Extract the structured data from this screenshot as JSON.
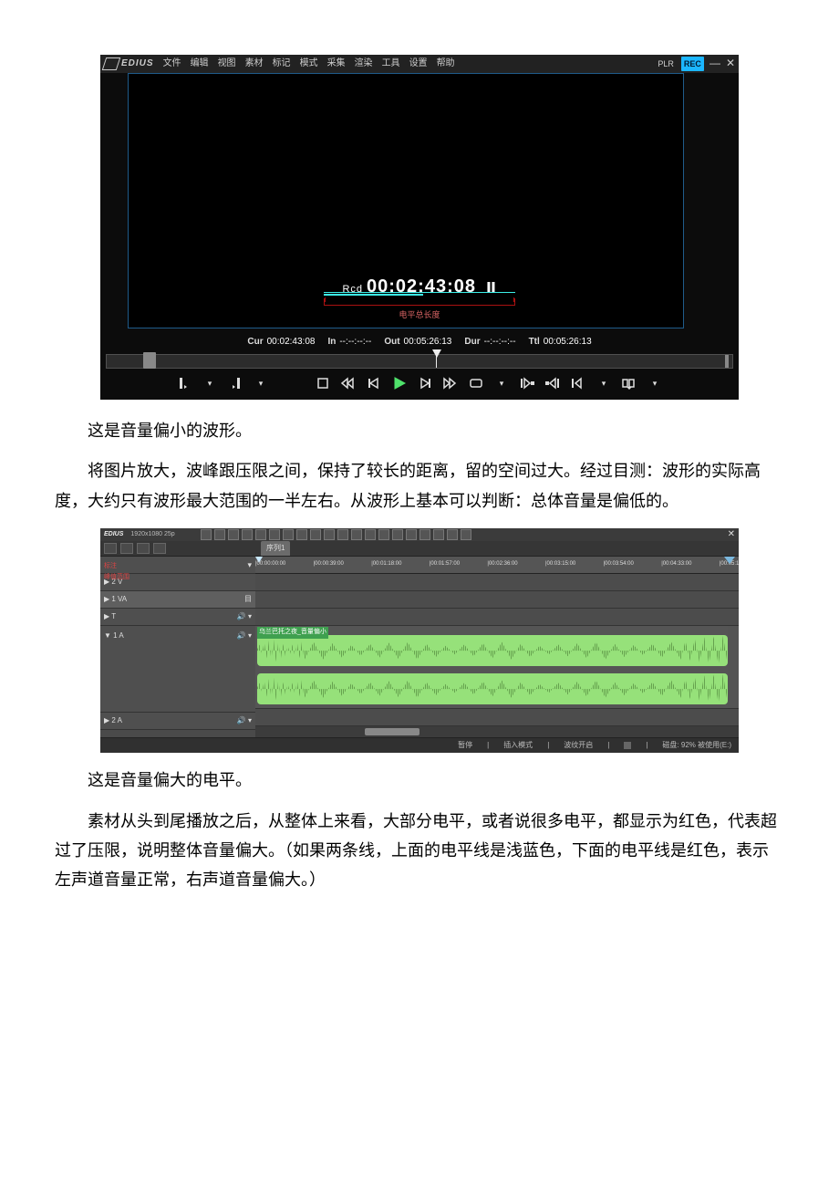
{
  "figure1": {
    "menubar": {
      "logo_text": "EDIUS",
      "items": [
        "文件",
        "编辑",
        "视图",
        "素材",
        "标记",
        "模式",
        "采集",
        "渲染",
        "工具",
        "设置",
        "帮助"
      ],
      "plr": "PLR",
      "rec": "REC"
    },
    "preview": {
      "rcd_label": "Rcd",
      "rcd_time": "00:02:43:08",
      "level_label": "电平总长度"
    },
    "info": {
      "cur_label": "Cur",
      "cur_value": "00:02:43:08",
      "in_label": "In",
      "in_value": "--:--:--:--",
      "out_label": "Out",
      "out_value": "00:05:26:13",
      "dur_label": "Dur",
      "dur_value": "--:--:--:--",
      "ttl_label": "Ttl",
      "ttl_value": "00:05:26:13"
    }
  },
  "para1": "这是音量偏小的波形。",
  "para2": "将图片放大，波峰跟压限之间，保持了较长的距离，留的空间过大。经过目测：波形的实际高度，大约只有波形最大范围的一半左右。从波形上基本可以判断：总体音量是偏低的。",
  "figure2": {
    "topbar": {
      "logo": "EDIUS",
      "dims": "1920x1080 25p"
    },
    "seqtab": "序列1",
    "ruler_ticks": [
      {
        "pct": 0,
        "label": "|00:00:00:00"
      },
      {
        "pct": 12,
        "label": "|00:00:39:00"
      },
      {
        "pct": 24,
        "label": "|00:01:18:00"
      },
      {
        "pct": 36,
        "label": "|00:01:57:00"
      },
      {
        "pct": 48,
        "label": "|00:02:36:00"
      },
      {
        "pct": 60,
        "label": "|00:03:15:00"
      },
      {
        "pct": 72,
        "label": "|00:03:54:00"
      },
      {
        "pct": 84,
        "label": "|00:04:33:00"
      },
      {
        "pct": 96,
        "label": "|00:05:1"
      }
    ],
    "track_headers": [
      {
        "label": "▶ 2 V"
      },
      {
        "label": "▶ 1 VA"
      },
      {
        "label": "▶ T"
      },
      {
        "label": "▼ 1 A"
      },
      {
        "label": "▶ 2 A"
      }
    ],
    "clip_title": "乌兰巴托之夜_音量偏小",
    "red_label_1": "标注",
    "red_label_2": "峰值范围",
    "status": {
      "pause": "暂停",
      "mode": "插入模式",
      "wave": "波纹开启",
      "disk": "磁盘: 92% 被使用(E:)"
    }
  },
  "para3": "这是音量偏大的电平。",
  "para4": "素材从头到尾播放之后，从整体上来看，大部分电平，或者说很多电平，都显示为红色，代表超过了压限，说明整体音量偏大。（如果两条线，上面的电平线是浅蓝色，下面的电平线是红色，表示左声道音量正常，右声道音量偏大。）"
}
